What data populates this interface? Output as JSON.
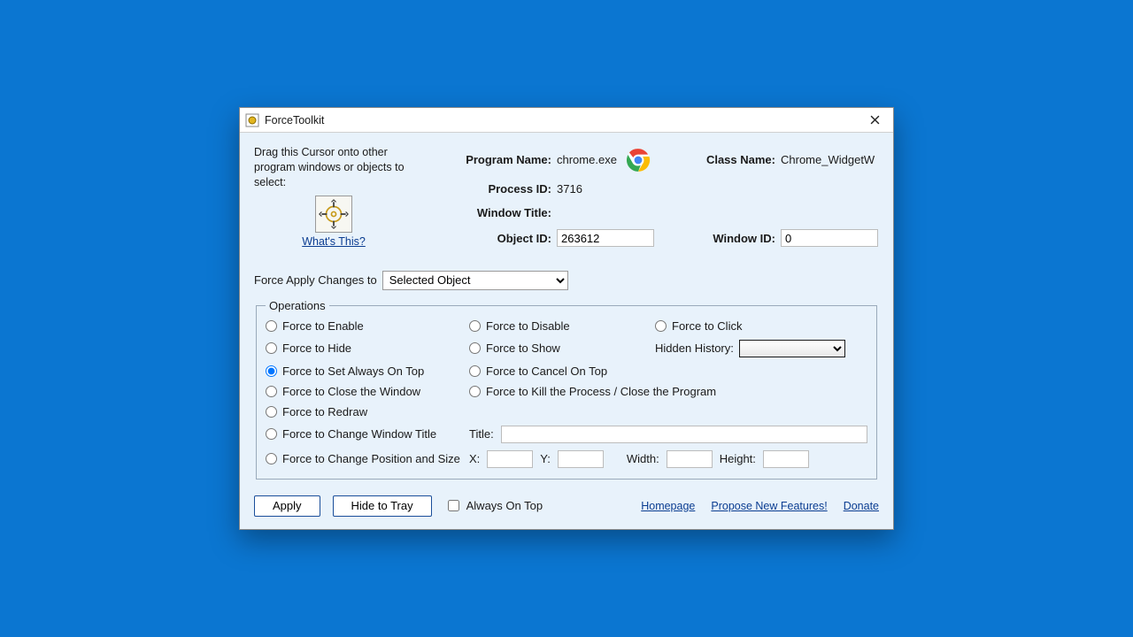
{
  "window": {
    "title": "ForceToolkit"
  },
  "drag": {
    "instruction": "Drag this Cursor onto other program windows or objects to select:",
    "whats_this": "What's This?"
  },
  "info": {
    "labels": {
      "program_name": "Program Name:",
      "process_id": "Process ID:",
      "window_title": "Window Title:",
      "object_id": "Object ID:",
      "class_name": "Class Name:",
      "window_id": "Window ID:"
    },
    "program_name": "chrome.exe",
    "process_id": "3716",
    "window_title": "",
    "object_id": "263612",
    "class_name": "Chrome_WidgetW",
    "window_id": "0"
  },
  "apply_to": {
    "label": "Force Apply Changes to",
    "value": "Selected Object"
  },
  "operations": {
    "legend": "Operations",
    "enable": "Force to Enable",
    "disable": "Force to Disable",
    "click": "Force to Click",
    "hide": "Force to Hide",
    "show": "Force to Show",
    "hidden_history_label": "Hidden History:",
    "always_on_top": "Force to Set Always On Top",
    "cancel_on_top": "Force to Cancel On Top",
    "close_window": "Force to Close the Window",
    "kill_process": "Force to Kill the Process / Close the Program",
    "redraw": "Force to Redraw",
    "change_title": "Force to Change Window Title",
    "change_pos_size": "Force to Change Position and Size",
    "title_label": "Title:",
    "x_label": "X:",
    "y_label": "Y:",
    "width_label": "Width:",
    "height_label": "Height:",
    "selected": "always_on_top",
    "title_value": "",
    "x_value": "",
    "y_value": "",
    "width_value": "",
    "height_value": "",
    "hidden_history_value": ""
  },
  "buttons": {
    "apply": "Apply",
    "hide_to_tray": "Hide to Tray",
    "always_on_top_check": "Always On Top"
  },
  "links": {
    "homepage": "Homepage",
    "propose": "Propose New Features!",
    "donate": "Donate"
  }
}
